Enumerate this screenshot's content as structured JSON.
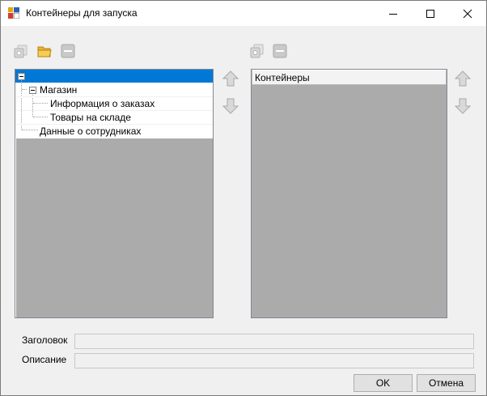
{
  "window": {
    "title": "Контейнеры для запуска"
  },
  "left_toolbar": {
    "icons": [
      "add-container-icon",
      "folder-open-icon",
      "remove-icon"
    ]
  },
  "right_toolbar": {
    "icons": [
      "add-container-icon",
      "remove-icon"
    ]
  },
  "tree": {
    "root_label": "",
    "items": [
      {
        "label": "Магазин",
        "level": 1
      },
      {
        "label": "Информация о заказах",
        "level": 2
      },
      {
        "label": "Товары на складе",
        "level": 2
      },
      {
        "label": "Данные о сотрудниках",
        "level": 1
      }
    ]
  },
  "containers_list": {
    "header": "Контейнеры"
  },
  "fields": {
    "title_label": "Заголовок",
    "title_value": "",
    "description_label": "Описание",
    "description_value": ""
  },
  "buttons": {
    "ok": "OK",
    "cancel": "Отмена"
  },
  "colors": {
    "selection": "#0078d7",
    "panel_empty": "#ababab",
    "window_bg": "#f0f0f0",
    "arrow_green": "#4a9a4a"
  }
}
